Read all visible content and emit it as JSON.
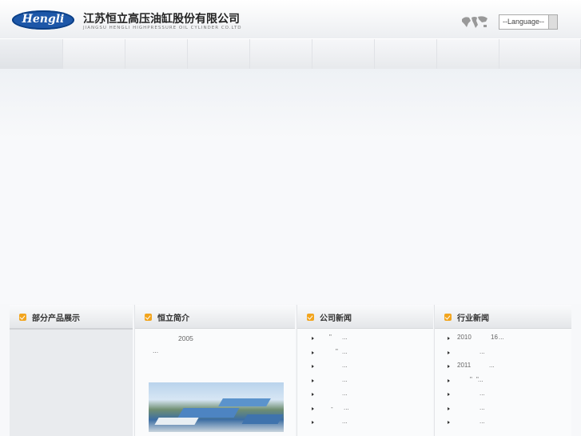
{
  "header": {
    "logo_text": "Hengli",
    "company_name": "江苏恒立高压油缸股份有限公司",
    "company_name_en": "JIANGSU HENGLI HIGHPRESSURE OIL CYLINDER CO.LTD",
    "language_select": "--Language--"
  },
  "panels": {
    "products": {
      "title": "部分产品展示"
    },
    "about": {
      "title": "恒立简介",
      "text_line1": "2005",
      "text_line2": "..."
    },
    "company_news": {
      "title": "公司新闻",
      "items": [
        {
          "text": "\"",
          "ellipsis": "..."
        },
        {
          "text": "\"",
          "ellipsis": "..."
        },
        {
          "text": "",
          "ellipsis": "..."
        },
        {
          "text": "",
          "ellipsis": "..."
        },
        {
          "text": "",
          "ellipsis": "..."
        },
        {
          "text": "-",
          "ellipsis": "..."
        },
        {
          "text": "",
          "ellipsis": "..."
        }
      ]
    },
    "industry_news": {
      "title": "行业新闻",
      "items": [
        {
          "text": "2010",
          "extra": "16",
          "ellipsis": "..."
        },
        {
          "text": "",
          "extra": "",
          "ellipsis": "..."
        },
        {
          "text": "2011",
          "extra": "",
          "ellipsis": "..."
        },
        {
          "text": "\"",
          "extra": "\"",
          "ellipsis": "..."
        },
        {
          "text": "",
          "extra": "",
          "ellipsis": "..."
        },
        {
          "text": "",
          "extra": "",
          "ellipsis": "..."
        },
        {
          "text": "",
          "extra": "",
          "ellipsis": "..."
        }
      ]
    }
  }
}
